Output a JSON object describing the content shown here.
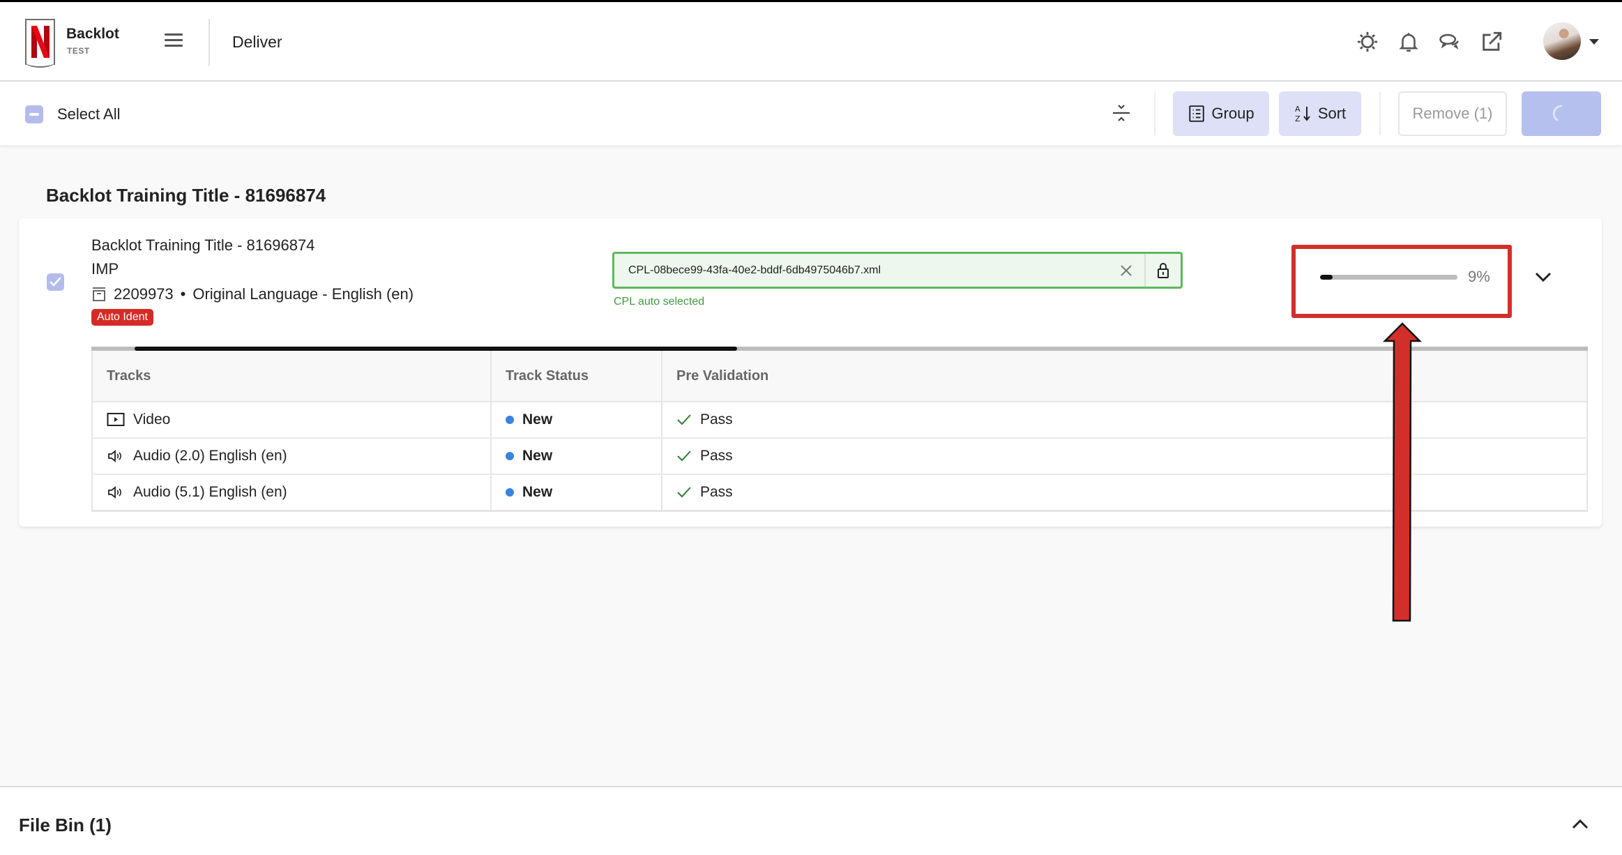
{
  "header": {
    "brand_name": "Backlot",
    "brand_env": "TEST",
    "page_name": "Deliver",
    "icons": [
      "settings-icon",
      "bell-icon",
      "chat-icon",
      "external-link-icon"
    ],
    "avatar": "user-avatar"
  },
  "toolbar": {
    "select_all_label": "Select All",
    "select_all_state": "indeterminate",
    "group_label": "Group",
    "sort_label": "Sort",
    "remove_label": "Remove (1)",
    "primary_state": "loading"
  },
  "main": {
    "section_title": "Backlot Training Title - 81696874",
    "item": {
      "checked": true,
      "title": "Backlot Training Title - 81696874",
      "type": "IMP",
      "package_id": "2209973",
      "separator": "•",
      "language": "Original Language - English (en)",
      "badge": "Auto Ident",
      "cpl": {
        "value": "CPL-08bece99-43fa-40e2-bddf-6db4975046b7.xml",
        "hint": "CPL auto selected"
      },
      "progress": {
        "percent": 9,
        "label": "9%"
      },
      "table": {
        "columns": [
          "Tracks",
          "Track Status",
          "Pre Validation"
        ],
        "rows": [
          {
            "icon": "video-icon",
            "track": "Video",
            "status": "New",
            "validation": "Pass"
          },
          {
            "icon": "speaker-icon",
            "track": "Audio (2.0) English (en)",
            "status": "New",
            "validation": "Pass"
          },
          {
            "icon": "speaker-icon",
            "track": "Audio (5.1) English (en)",
            "status": "New",
            "validation": "Pass"
          }
        ]
      }
    }
  },
  "footer": {
    "file_bin_label": "File Bin (1)"
  },
  "colors": {
    "accent": "#b4bced",
    "badge": "#d52b27",
    "cpl_border": "#5cb85c",
    "status_new": "#3b82e0",
    "pass_check": "#2e7d32",
    "annotation": "#d32f2a"
  }
}
